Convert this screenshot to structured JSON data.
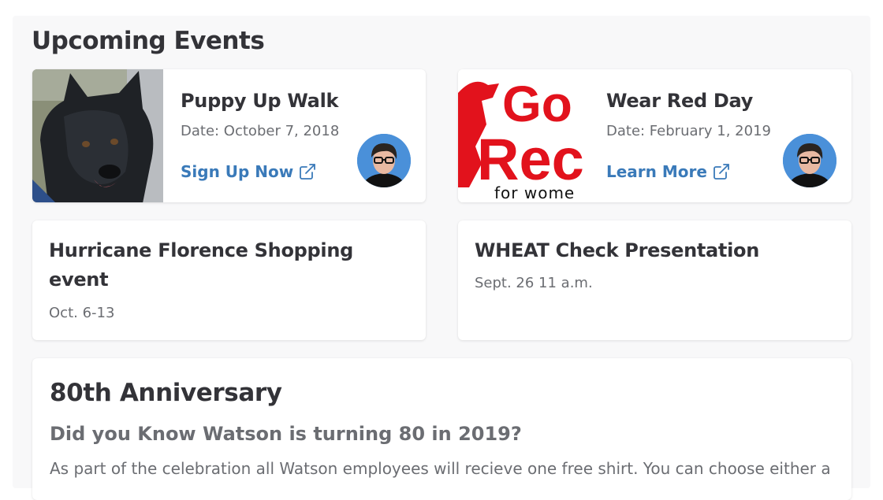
{
  "section": {
    "title": "Upcoming Events"
  },
  "events": [
    {
      "title": "Puppy Up Walk",
      "date": "Date: October 7, 2018",
      "link_label": "Sign Up Now",
      "image": "dog-photo"
    },
    {
      "title": "Wear Red Day",
      "date": "Date: February 1, 2019",
      "link_label": "Learn More",
      "image": "go-red-for-women-logo",
      "image_text": {
        "line1": "Go",
        "line2": "Rec",
        "line3": "for wome"
      }
    }
  ],
  "small_events": [
    {
      "title": "Hurricane Florence Shopping event",
      "date": "Oct. 6-13"
    },
    {
      "title": "WHEAT Check Presentation",
      "date": "Sept. 26 11 a.m."
    }
  ],
  "anniversary": {
    "title": "80th Anniversary",
    "subtitle": "Did you Know Watson is turning 80 in 2019?",
    "body": "As part of the celebration all Watson employees will recieve one free shirt. You can choose either a"
  },
  "icons": {
    "external_link": "external-link-icon"
  },
  "colors": {
    "link": "#3a7ab9",
    "brand_red": "#e2121c",
    "avatar_bg": "#4a90d9"
  }
}
